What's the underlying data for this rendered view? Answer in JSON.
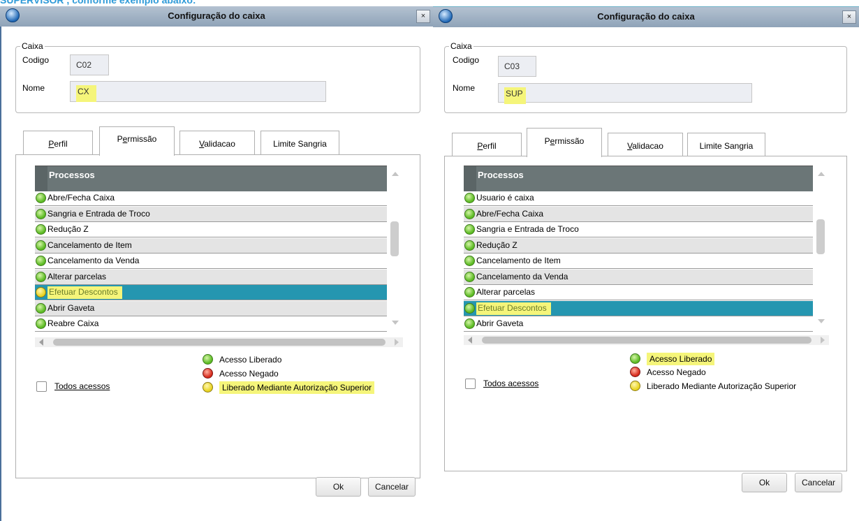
{
  "top_caption": "SUPERVISOR , conforme exemplo abaixo:",
  "legend_items": [
    {
      "label": "Acesso Liberado",
      "color": "green"
    },
    {
      "label": "Acesso Negado",
      "color": "red"
    },
    {
      "label": "Liberado Mediante Autorização Superior",
      "color": "yellow"
    }
  ],
  "dialogs": [
    {
      "title": "Configuração do caixa",
      "close_label": "×",
      "group_label": "Caixa",
      "codigo_label": "Codigo",
      "codigo_value": "C02",
      "nome_label": "Nome",
      "nome_value": "CX",
      "tabs": [
        {
          "label": "Perfil",
          "accel": "P",
          "rest": "erfil"
        },
        {
          "label": "Permissão",
          "accel": "e",
          "pre": "P",
          "rest": "rmissão"
        },
        {
          "label": "Validacao",
          "accel": "V",
          "rest": "alidacao"
        },
        {
          "label": "Limite Sangria"
        }
      ],
      "grid_header": "Processos",
      "rows": [
        {
          "label": "Abre/Fecha Caixa",
          "status": "green"
        },
        {
          "label": "Sangria e Entrada de Troco",
          "status": "green"
        },
        {
          "label": "Redução Z",
          "status": "green"
        },
        {
          "label": "Cancelamento de Item",
          "status": "green"
        },
        {
          "label": "Cancelamento da Venda",
          "status": "green"
        },
        {
          "label": "Alterar parcelas",
          "status": "green"
        },
        {
          "label": "Efetuar Descontos",
          "status": "yellow",
          "selected": true
        },
        {
          "label": "Abrir Gaveta",
          "status": "green"
        },
        {
          "label": "Reabre Caixa",
          "status": "green"
        }
      ],
      "todos_label": "Todos acessos",
      "ok_label": "Ok",
      "cancel_label": "Cancelar"
    },
    {
      "title": "Configuração do caixa",
      "close_label": "×",
      "group_label": "Caixa",
      "codigo_label": "Codigo",
      "codigo_value": "C03",
      "nome_label": "Nome",
      "nome_value": "SUP",
      "tabs": [
        {
          "label": "Perfil"
        },
        {
          "label": "Permissão"
        },
        {
          "label": "Validacao"
        },
        {
          "label": "Limite Sangria"
        }
      ],
      "grid_header": "Processos",
      "rows": [
        {
          "label": "Usuario é caixa",
          "status": "green"
        },
        {
          "label": "Abre/Fecha Caixa",
          "status": "green"
        },
        {
          "label": "Sangria e Entrada de Troco",
          "status": "green"
        },
        {
          "label": "Redução Z",
          "status": "green"
        },
        {
          "label": "Cancelamento de Item",
          "status": "green"
        },
        {
          "label": "Cancelamento da Venda",
          "status": "green"
        },
        {
          "label": "Alterar parcelas",
          "status": "green"
        },
        {
          "label": "Efetuar Descontos",
          "status": "green",
          "selected": true
        },
        {
          "label": "Abrir Gaveta",
          "status": "green"
        }
      ],
      "todos_label": "Todos acessos",
      "ok_label": "Ok",
      "cancel_label": "Cancelar"
    }
  ]
}
